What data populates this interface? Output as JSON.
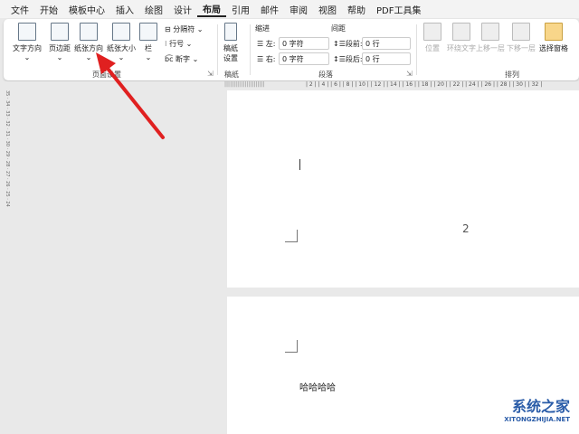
{
  "menus": [
    "文件",
    "开始",
    "模板中心",
    "插入",
    "绘图",
    "设计",
    "布局",
    "引用",
    "邮件",
    "审阅",
    "视图",
    "帮助",
    "PDF工具集"
  ],
  "active_menu": "布局",
  "page_setup": {
    "text_dir": "文字方向",
    "margins": "页边距",
    "orientation": "纸张方向",
    "size": "纸张大小",
    "columns": "栏",
    "breaks": "分隔符",
    "line_numbers": "行号",
    "hyphenation": "断字",
    "group": "页面设置"
  },
  "draft": {
    "settings": "稿纸设置",
    "group": "稿纸"
  },
  "paragraph": {
    "indent": "缩进",
    "spacing": "间距",
    "left_label": "左:",
    "left_value": "0 字符",
    "right_label": "右:",
    "right_value": "0 字符",
    "before_label": "段前:",
    "before_value": "0 行",
    "after_label": "段后:",
    "after_value": "0 行",
    "group": "段落"
  },
  "arrange": {
    "position": "位置",
    "wrap": "环绕文字",
    "forward": "上移一层",
    "backward": "下移一层",
    "selection_pane": "选择窗格",
    "group": "排列"
  },
  "ruler": "| 2 |  | 4 |  | 6 |  | 8 |  | 10 |  | 12 |  | 14 |  | 16 |  | 18 |  | 20 |  | 22 |  | 24 |  | 26 |  | 28 |  | 30 |  | 32 |",
  "vruler": "35 · 34 · 33 · 32 · 31 · 30 · 29 · 28 · 27 · 26 · 25 · 24",
  "document": {
    "page_number": "2",
    "text": "哈哈哈哈"
  },
  "watermark": {
    "name": "系统之家",
    "url": "XITONGZHIJIA.NET"
  },
  "colors": {
    "arrow": "#e02020"
  }
}
